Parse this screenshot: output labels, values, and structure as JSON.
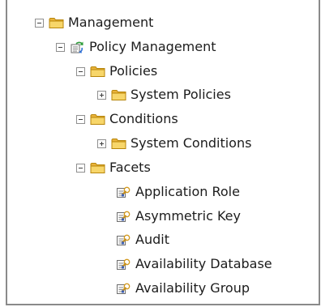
{
  "tree": {
    "management": {
      "label": "Management",
      "icon": "folder-icon",
      "toggle": "collapse"
    },
    "policy_management": {
      "label": "Policy Management",
      "icon": "policy-management-icon",
      "toggle": "collapse"
    },
    "policies": {
      "label": "Policies",
      "icon": "folder-icon",
      "toggle": "collapse"
    },
    "system_policies": {
      "label": "System Policies",
      "icon": "folder-icon",
      "toggle": "expand"
    },
    "conditions": {
      "label": "Conditions",
      "icon": "folder-icon",
      "toggle": "collapse"
    },
    "system_conditions": {
      "label": "System Conditions",
      "icon": "folder-icon",
      "toggle": "expand"
    },
    "facets": {
      "label": "Facets",
      "icon": "folder-icon",
      "toggle": "collapse"
    },
    "facet_items": [
      {
        "label": "Application Role",
        "icon": "facet-icon"
      },
      {
        "label": "Asymmetric Key",
        "icon": "facet-icon"
      },
      {
        "label": "Audit",
        "icon": "facet-icon"
      },
      {
        "label": "Availability Database",
        "icon": "facet-icon"
      },
      {
        "label": "Availability Group",
        "icon": "facet-icon"
      }
    ]
  },
  "colors": {
    "folder_fill": "#f4c94f",
    "folder_stroke": "#b8860b",
    "border": "#8a8a8a",
    "text": "#1c1c1c"
  }
}
